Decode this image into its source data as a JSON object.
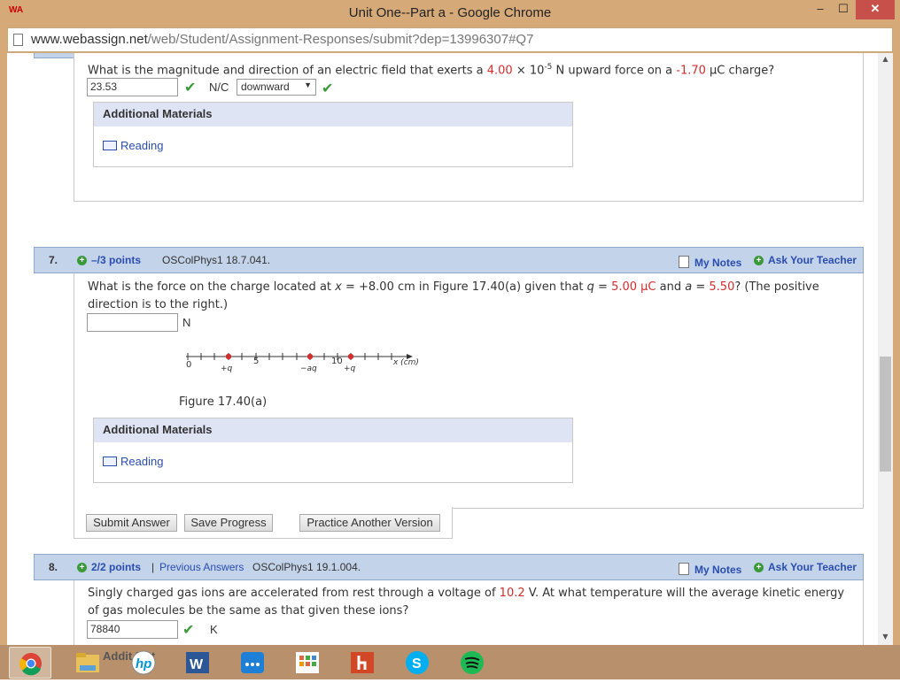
{
  "window": {
    "app_icon_text": "WA",
    "title": "Unit One--Part a - Google Chrome",
    "min_label": "–",
    "max_label": "☐",
    "close_label": "✕"
  },
  "address_bar": {
    "url_host": "www.webassign.net",
    "url_path": "/web/Student/Assignment-Responses/submit?dep=13996307#Q7"
  },
  "q6": {
    "text_a": "What is the magnitude and direction of an electric field that exerts a ",
    "force_value": "4.00",
    "times": " × 10",
    "exponent": "-5",
    "text_b": " N upward force on a ",
    "charge_value": "-1.70",
    "text_c": " µC charge?",
    "answer": "23.53",
    "unit": "N/C",
    "direction_selected": "downward",
    "additional_materials_label": "Additional Materials",
    "reading_label": "Reading"
  },
  "q7": {
    "number": "7.",
    "points": "–/3 points",
    "source": "OSColPhys1 18.7.041.",
    "my_notes": "My Notes",
    "ask_teacher": "Ask Your Teacher",
    "text_a": "What is the force on the charge located at ",
    "x_var": "x",
    "text_b": " = +8.00 cm in Figure 17.40(a) given that ",
    "q_var": "q",
    "text_c": " = ",
    "q_value": "5.00 µC",
    "text_d": " and ",
    "a_var": "a",
    "text_e": " = ",
    "a_value": "5.50",
    "text_f": "? (The positive direction is to the right.)",
    "answer": "",
    "unit": "N",
    "figure": {
      "tick_0": "0",
      "tick_5": "5",
      "tick_10": "10",
      "axis_label": "x (cm)",
      "charge_left": "+q",
      "charge_mid": "−aq",
      "charge_right": "+q",
      "caption": "Figure 17.40(a)"
    },
    "additional_materials_label": "Additional Materials",
    "reading_label": "Reading",
    "buttons": {
      "submit": "Submit Answer",
      "save": "Save Progress",
      "practice": "Practice Another Version"
    }
  },
  "q8": {
    "number": "8.",
    "points": "2/2 points",
    "separator": "|",
    "previous_answers": "Previous Answers",
    "source": "OSColPhys1 19.1.004.",
    "my_notes": "My Notes",
    "ask_teacher": "Ask Your Teacher",
    "text_a": "Singly charged gas ions are accelerated from rest through a voltage of ",
    "voltage": "10.2",
    "text_b": " V. At what temperature will the average kinetic energy of gas molecules be the same as that given these ions?",
    "answer": "78840",
    "unit": "K"
  },
  "taskbar": {
    "peek_text": "Addit    Mat",
    "items": [
      "chrome",
      "file-explorer",
      "hp",
      "word",
      "connect",
      "apps",
      "pdf",
      "skype",
      "spotify"
    ]
  },
  "colors": {
    "accent_red": "#d32d2d",
    "link_blue": "#2a4db0",
    "header_blue": "#c3d3ea",
    "check_green": "#3a9a3a",
    "window_frame": "#d6a979"
  }
}
